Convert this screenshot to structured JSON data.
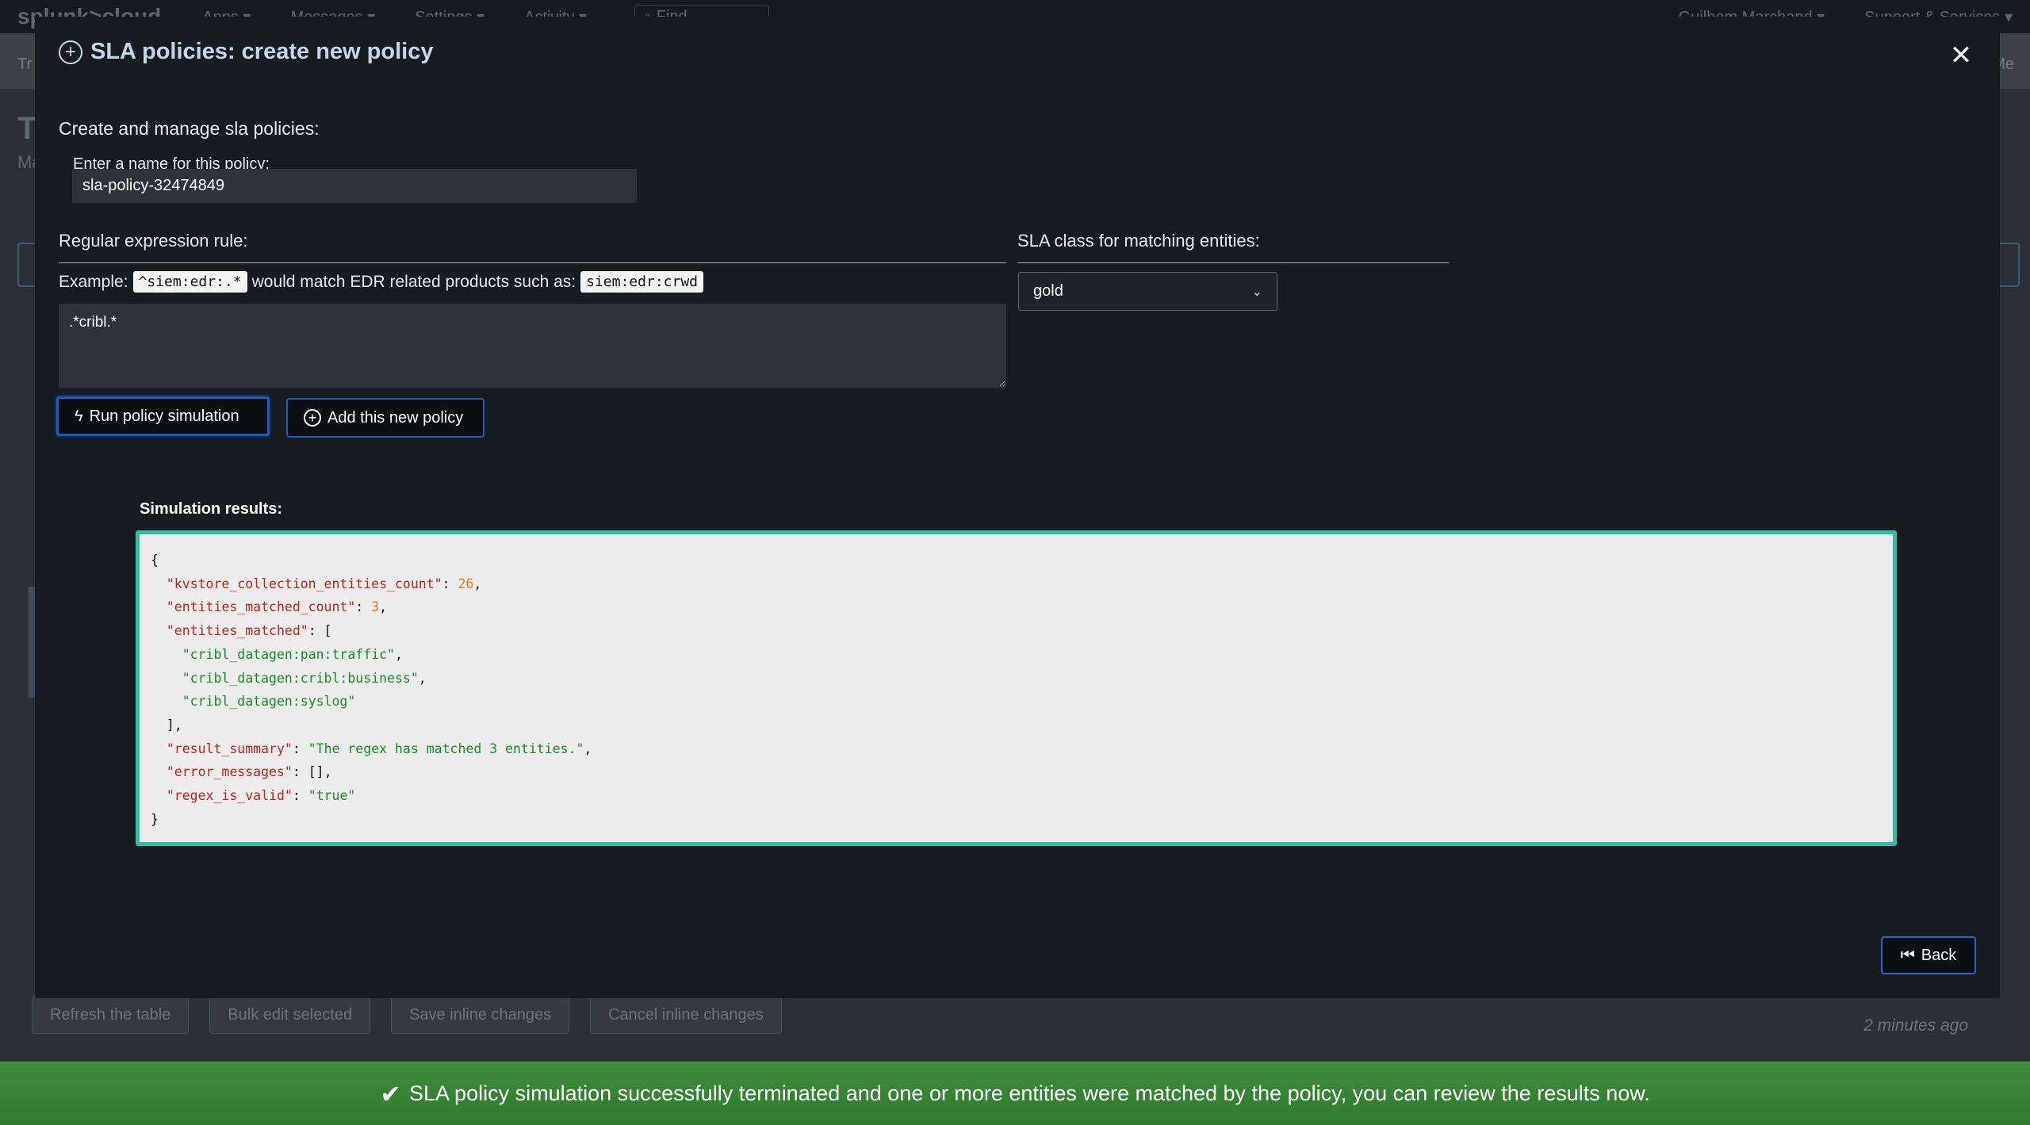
{
  "background": {
    "logo": "splunk>cloud",
    "menus": [
      "Apps ▾",
      "Messages ▾",
      "Settings ▾",
      "Activity ▾"
    ],
    "find_placeholder": "Find",
    "user": "Guilhem Marchand ▾",
    "support": "Support & Services ▾",
    "page_title": "Tr",
    "page_subtitle": "Ma",
    "breadcrumb": "Tr",
    "right_link": "Me",
    "toolbar": {
      "refresh": "Refresh the table",
      "bulk_edit": "Bulk edit selected",
      "save_inline": "Save inline changes",
      "cancel_inline": "Cancel inline changes"
    },
    "updated": "2 minutes ago"
  },
  "modal": {
    "title": "SLA policies: create new policy",
    "heading": "Create and manage sla policies:",
    "name_label": "Enter a name for this policy:",
    "name_value": "sla-policy-32474849",
    "regex_heading": "Regular expression rule:",
    "sla_heading": "SLA class for matching entities:",
    "example_prefix": "Example:",
    "example_code1": "^siem:edr:.*",
    "example_middle": "would match EDR related products such as:",
    "example_code2": "siem:edr:crwd",
    "regex_value": ".*cribl.*",
    "sla_selected": "gold",
    "run_button": "Run policy simulation",
    "add_button": "Add this new policy",
    "sim_label": "Simulation results:",
    "back_button": "Back",
    "simulation": {
      "kvstore_collection_entities_count": "26",
      "entities_matched_count": "3",
      "entities_matched": [
        "\"cribl_datagen:pan:traffic\"",
        "\"cribl_datagen:cribl:business\"",
        "\"cribl_datagen:syslog\""
      ],
      "result_summary": "\"The regex has matched 3 entities.\"",
      "error_messages": "[]",
      "regex_is_valid": "\"true\""
    }
  },
  "toast": {
    "message": "SLA policy simulation successfully terminated and one or more entities were matched by the policy, you can review the results now."
  },
  "colors": {
    "accent": "#1d5cba",
    "sim_border": "#2bbfa3",
    "toast_bg": "#3e8d3b"
  }
}
